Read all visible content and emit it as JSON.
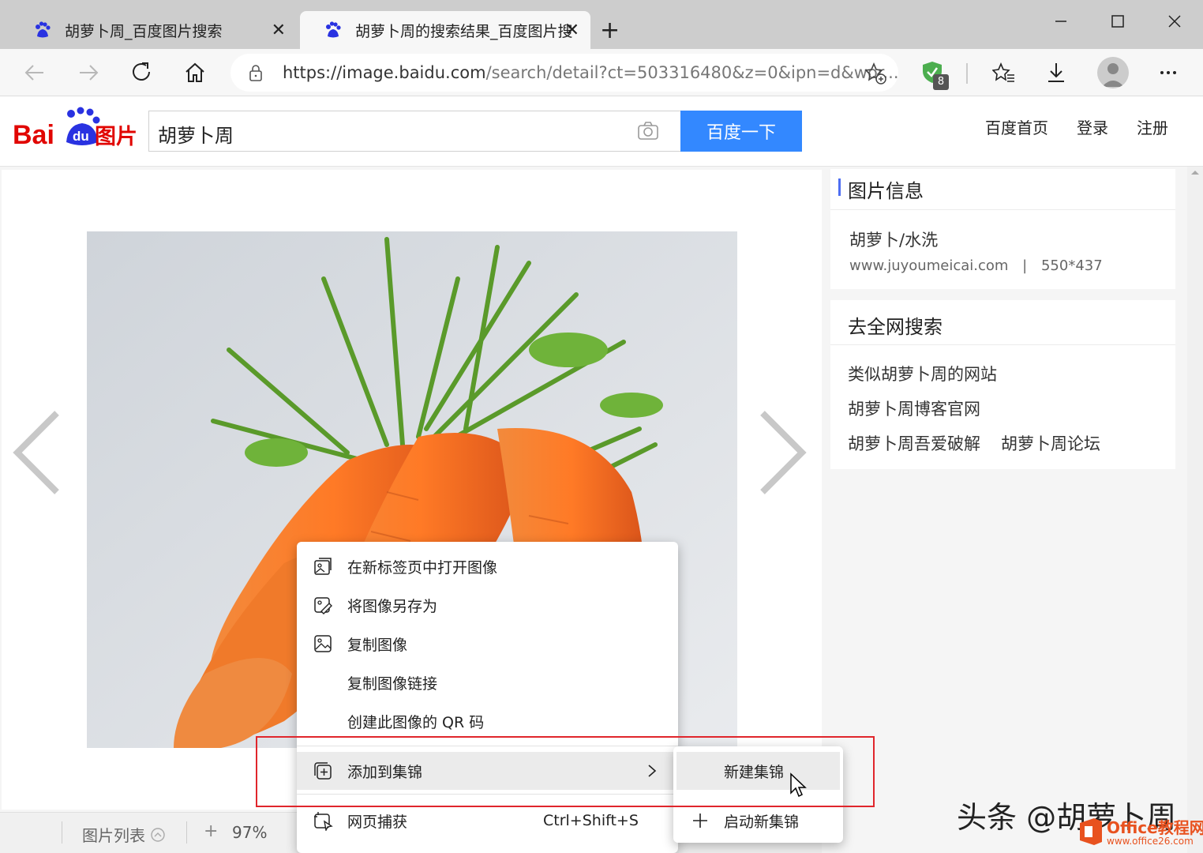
{
  "browser": {
    "tabs": [
      {
        "title": "胡萝卜周_百度图片搜索",
        "close": "✕"
      },
      {
        "title": "胡萝卜周的搜索结果_百度图片搜",
        "close": "✕"
      }
    ],
    "new_tab": "+",
    "url_main": "https://image.baidu.com",
    "url_rest": "/search/detail?ct=503316480&z=0&ipn=d&wor...",
    "extension_badge": "8"
  },
  "baidu": {
    "logo_text": "Bai du 图片",
    "search_value": "胡萝卜周",
    "search_button": "百度一下",
    "nav": [
      "百度首页",
      "登录",
      "注册"
    ]
  },
  "info_panel": {
    "title": "图片信息",
    "image_name": "胡萝卜/水洗",
    "source": "www.juyoumeicai.com",
    "separator": "|",
    "size": "550*437"
  },
  "search_panel": {
    "title": "去全网搜索",
    "links": [
      "类似胡萝卜周的网站",
      "胡萝卜周博客官网",
      "胡萝卜周吾爱破解",
      "胡萝卜周论坛"
    ]
  },
  "bottom": {
    "list_label": "图片列表",
    "zoom_in": "+",
    "zoom": "97%"
  },
  "context_menu": {
    "items": [
      {
        "label": "在新标签页中打开图像",
        "icon": "open-new-tab-icon"
      },
      {
        "label": "将图像另存为",
        "icon": "save-image-icon"
      },
      {
        "label": "复制图像",
        "icon": "copy-image-icon"
      },
      {
        "label": "复制图像链接",
        "icon": ""
      },
      {
        "label": "创建此图像的 QR 码",
        "icon": ""
      },
      {
        "label": "添加到集锦",
        "icon": "collections-icon"
      },
      {
        "label": "网页捕获",
        "icon": "web-capture-icon",
        "shortcut": "Ctrl+Shift+S"
      }
    ],
    "submenu": [
      "新建集锦",
      "启动新集锦"
    ]
  },
  "watermark": {
    "text": "头条 @胡萝卜周",
    "logo_top": "Office教程网",
    "logo_bottom": "www.office26.com"
  },
  "colors": {
    "baidu_blue": "#3388ff",
    "baidu_red": "#e10602",
    "highlight_red": "#e0262c",
    "accent_bar": "#4e6ef2"
  }
}
